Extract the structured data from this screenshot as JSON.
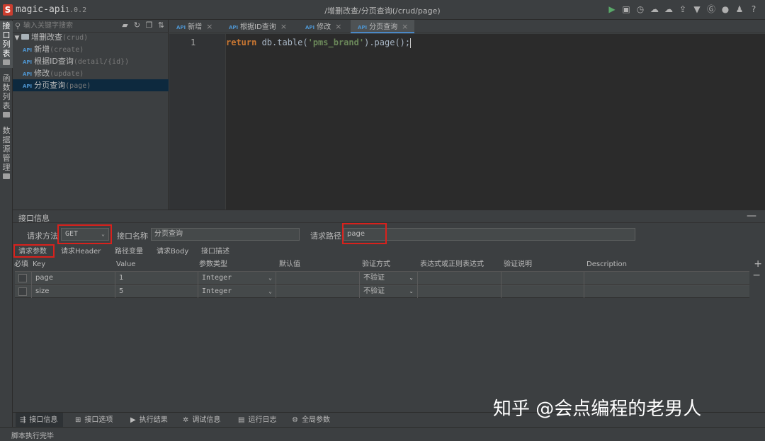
{
  "app": {
    "name": "magic-api",
    "version": "1.0.2",
    "window_title": "/增删改查/分页查询(/crud/page)"
  },
  "toolbar": {
    "icons": [
      "run-icon",
      "save-icon",
      "history-icon",
      "upload-icon",
      "download-icon",
      "push-icon",
      "skin-icon",
      "gitee-icon",
      "github-icon",
      "qq-icon",
      "help-icon"
    ]
  },
  "left_strip": [
    {
      "label": "接\n口\n列\n表"
    },
    {
      "label": "函\n数\n列\n表"
    },
    {
      "label": "数\n据\n源\n管\n理"
    }
  ],
  "sidebar": {
    "search_placeholder": "输入关键字搜索",
    "group": {
      "label": "增删改查",
      "path": "(crud)"
    },
    "api_tag": "API",
    "items": [
      {
        "label": "新增",
        "path": "(create)"
      },
      {
        "label": "根据ID查询",
        "path": "(detail/{id})"
      },
      {
        "label": "修改",
        "path": "(update)"
      },
      {
        "label": "分页查询",
        "path": "(page)"
      }
    ]
  },
  "tabs": [
    {
      "label": "新增",
      "close": "×"
    },
    {
      "label": "根据ID查询",
      "close": "×"
    },
    {
      "label": "修改",
      "close": "×"
    },
    {
      "label": "分页查询",
      "close": "×"
    }
  ],
  "editor": {
    "line_number": "1",
    "code": {
      "keyword": "return",
      "before": " db.table(",
      "string": "'pms_brand'",
      "after": ").page();"
    }
  },
  "panel": {
    "title": "接口信息",
    "minimize": "—",
    "method_label": "请求方法",
    "method_value": "GET",
    "name_label": "接口名称",
    "name_value": "分页查询",
    "path_label": "请求路径",
    "path_value": "page",
    "param_tabs": [
      "请求参数",
      "请求Header",
      "路径变量",
      "请求Body",
      "接口描述"
    ],
    "columns": [
      "必填",
      "Key",
      "Value",
      "参数类型",
      "默认值",
      "验证方式",
      "表达式或正则表达式",
      "验证说明",
      "Description"
    ],
    "rows": [
      {
        "key": "page",
        "value": "1",
        "type": "Integer",
        "default": "",
        "validation": "不验证",
        "expression": "",
        "message": "",
        "description": ""
      },
      {
        "key": "size",
        "value": "5",
        "type": "Integer",
        "default": "",
        "validation": "不验证",
        "expression": "",
        "message": "",
        "description": ""
      }
    ],
    "add": "+",
    "remove": "−"
  },
  "bottom_tabs": [
    {
      "label": "接口信息",
      "icon": "info-icon"
    },
    {
      "label": "接口选项",
      "icon": "options-icon"
    },
    {
      "label": "执行结果",
      "icon": "play-icon"
    },
    {
      "label": "调试信息",
      "icon": "bug-icon"
    },
    {
      "label": "运行日志",
      "icon": "log-icon"
    },
    {
      "label": "全局参数",
      "icon": "gear-icon"
    }
  ],
  "status": "脚本执行完毕",
  "watermark": "知乎 @会点编程的老男人",
  "colors": {
    "accent": "#4a88c7",
    "highlight_box": "#d9211c",
    "keyword": "#cc7832",
    "string": "#6a8759",
    "api_tag": "#4e94ce",
    "logo": "#cc3e2f"
  }
}
